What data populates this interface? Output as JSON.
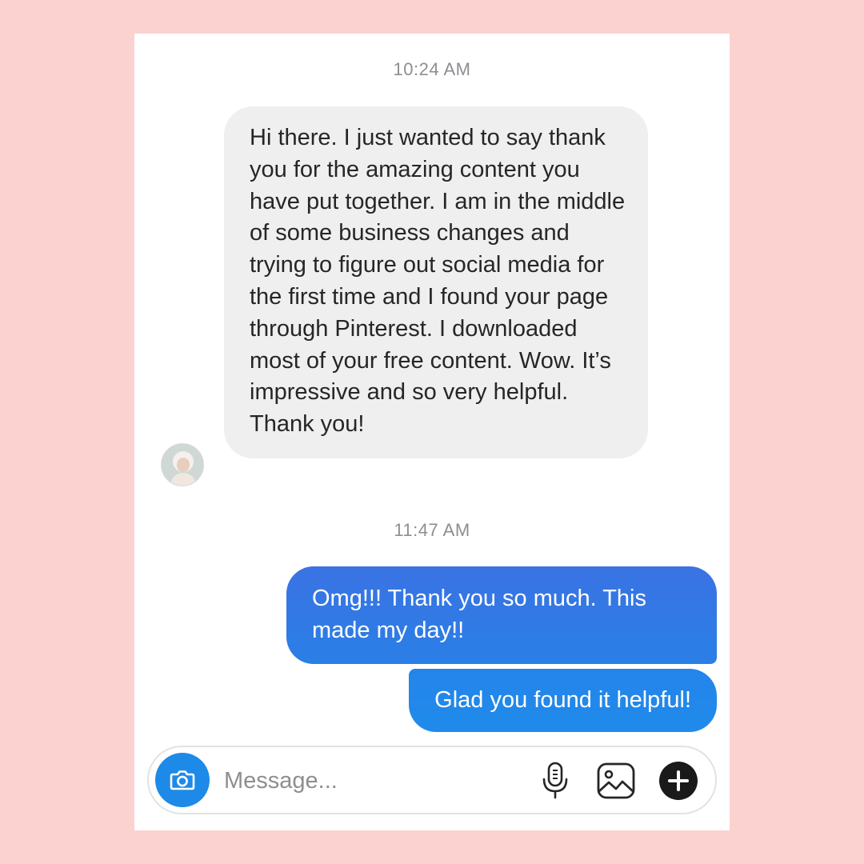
{
  "conversation": {
    "timestamps": [
      "10:24 AM",
      "11:47 AM"
    ],
    "incoming_message": "Hi there. I just wanted to say thank you for the amazing content you have put together. I am in the middle of some business changes and trying to figure out social media for the first time and I found your page through Pinterest. I downloaded most of your free content. Wow. It’s impressive and so very helpful. Thank you!",
    "outgoing_messages": [
      "Omg!!! Thank you so much. This made my day!!",
      "Glad you found it helpful!"
    ],
    "sender_avatar": "contact-avatar"
  },
  "composer": {
    "placeholder": "Message...",
    "icons": [
      "camera-icon",
      "microphone-icon",
      "gallery-icon",
      "plus-icon"
    ]
  },
  "colors": {
    "background": "#fcd2d0",
    "incoming_bubble": "#efefef",
    "outgoing_bubble": "#2a7fe6",
    "camera_button": "#1e8ae8"
  }
}
